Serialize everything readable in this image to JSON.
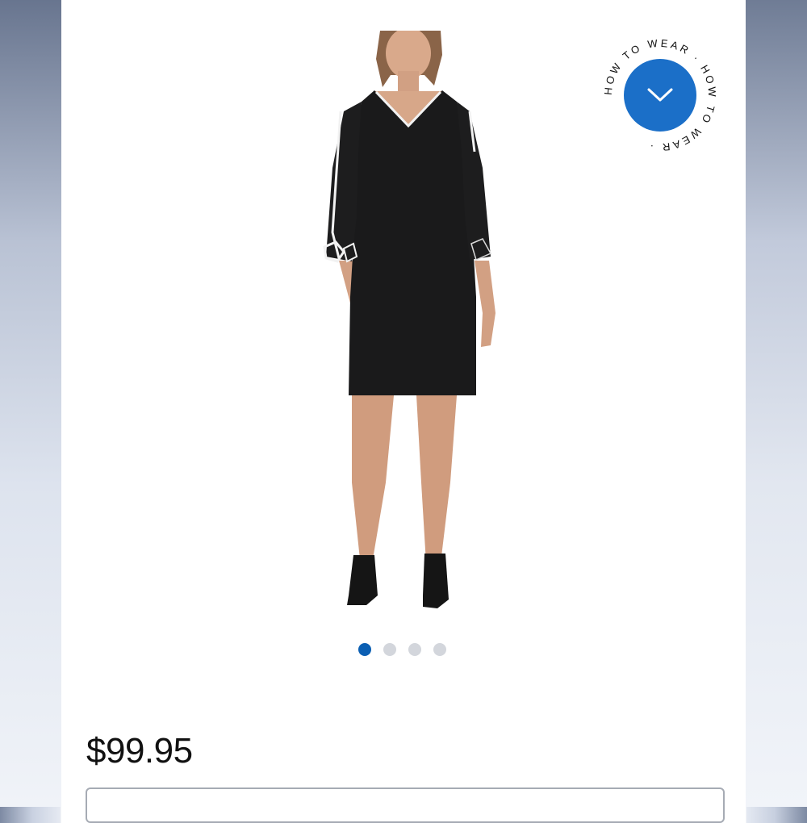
{
  "product": {
    "image_alt": "Black V-neck dress with contrast piping and bow cuffs",
    "price": "$99.95"
  },
  "how_to_wear": {
    "ring_text": "HOW TO WEAR · HOW TO WEAR ·",
    "icon": "chevron-down-icon",
    "accent_color": "#1b6fc8"
  },
  "carousel": {
    "total": 4,
    "active_index": 0,
    "active_color": "#0b5fb3",
    "inactive_color": "#d3d6dc"
  }
}
